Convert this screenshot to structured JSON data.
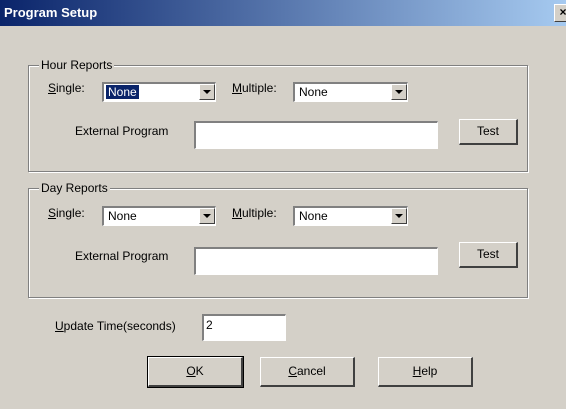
{
  "window": {
    "title": "Program Setup",
    "close_label": "×"
  },
  "hour_reports": {
    "legend": "Hour Reports",
    "single_label_u": "S",
    "single_label_rest": "ingle:",
    "single_value": "None",
    "multiple_label_u": "M",
    "multiple_label_rest": "ultiple:",
    "multiple_value": "None",
    "external_program_label": "External Program",
    "external_program_value": "",
    "test_label": "Test"
  },
  "day_reports": {
    "legend": "Day Reports",
    "single_label_u": "S",
    "single_label_rest": "ingle:",
    "single_value": "None",
    "multiple_label_u": "M",
    "multiple_label_rest": "ultiple:",
    "multiple_value": "None",
    "external_program_label": "External Program",
    "external_program_value": "",
    "test_label": "Test"
  },
  "update_time": {
    "label_u": "U",
    "label_rest": "pdate Time(seconds)",
    "value": "2"
  },
  "buttons": {
    "ok_u": "O",
    "ok_rest": "K",
    "cancel_u": "C",
    "cancel_rest": "ancel",
    "help_u": "H",
    "help_rest": "elp"
  }
}
